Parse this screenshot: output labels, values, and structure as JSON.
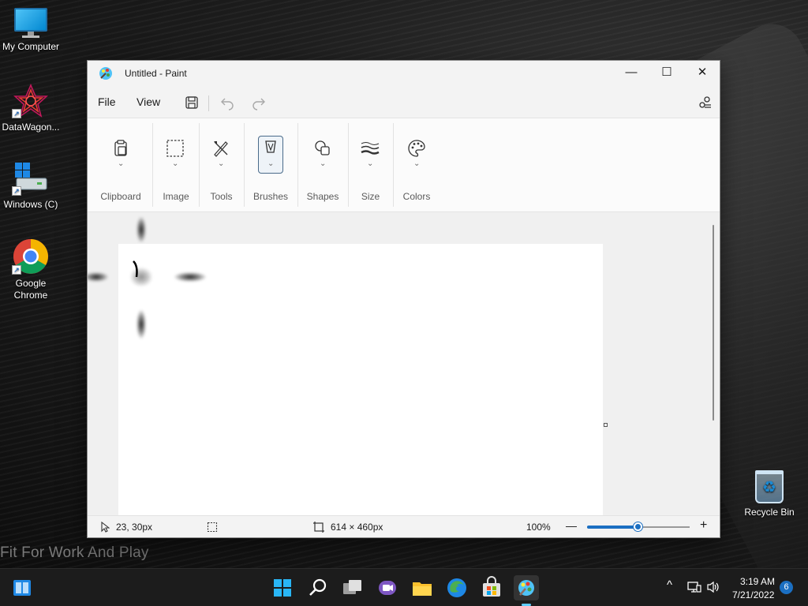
{
  "desktop": {
    "slogan": "Fit For Work And Play",
    "icons": [
      {
        "label": "My Computer",
        "icon": "monitor-icon"
      },
      {
        "label": "DataWagon...",
        "icon": "datawagon-icon"
      },
      {
        "label": "Windows (C)",
        "icon": "drive-icon"
      },
      {
        "label": "Google Chrome",
        "icon": "chrome-icon"
      },
      {
        "label": "Recycle Bin",
        "icon": "recycle-bin-icon"
      }
    ]
  },
  "window": {
    "title": "Untitled - Paint",
    "controls": {
      "minimize": "—",
      "maximize": "☐",
      "close": "✕"
    }
  },
  "menubar": {
    "file": "File",
    "view": "View"
  },
  "ribbon": {
    "groups": [
      {
        "label": "Clipboard",
        "icon": "clipboard-icon"
      },
      {
        "label": "Image",
        "icon": "selection-icon"
      },
      {
        "label": "Tools",
        "icon": "tools-icon"
      },
      {
        "label": "Brushes",
        "icon": "brush-icon"
      },
      {
        "label": "Shapes",
        "icon": "shapes-icon"
      },
      {
        "label": "Size",
        "icon": "stroke-size-icon"
      },
      {
        "label": "Colors",
        "icon": "palette-icon"
      }
    ]
  },
  "statusbar": {
    "cursor_position": "23, 30px",
    "canvas_size": "614 × 460px",
    "zoom": "100%",
    "zoom_fraction": 0.5
  },
  "taskbar": {
    "time": "3:19 AM",
    "date": "7/21/2022",
    "notification_count": "6"
  },
  "colors": {
    "accent": "#1b6fc2",
    "taskbar_bg": "#1c1c1c",
    "window_bg": "#f3f3f3"
  }
}
